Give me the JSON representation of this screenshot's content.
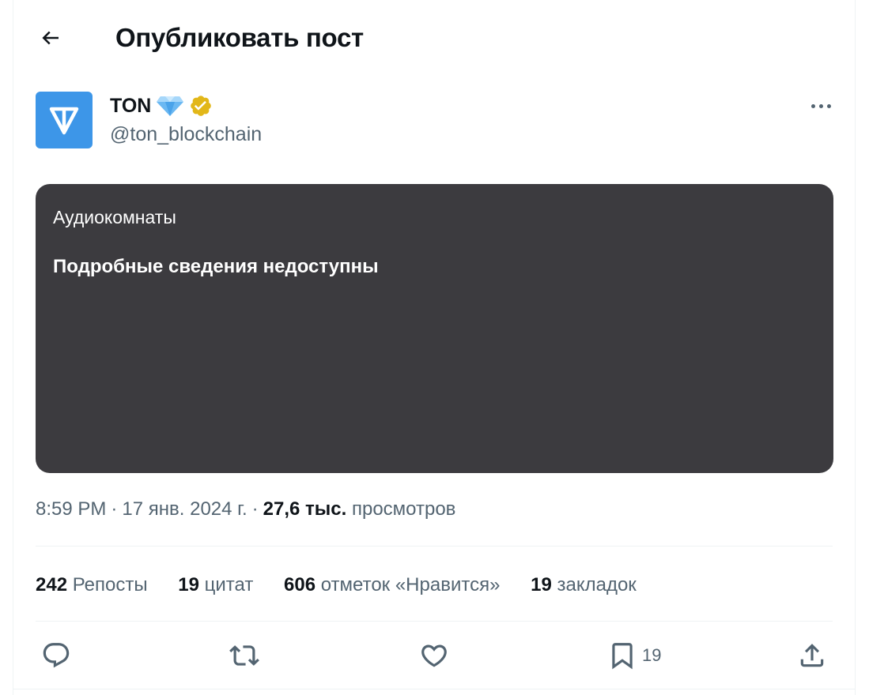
{
  "header": {
    "title": "Опубликовать пост",
    "back_icon": "arrow-left-icon"
  },
  "author": {
    "display_name": "TON",
    "handle": "@ton_blockchain",
    "badges": [
      "diamond-icon",
      "verified-badge-icon"
    ],
    "avatar_color": "#3d96e8",
    "verified_color": "#e2b719"
  },
  "audio_card": {
    "label": "Аудиокомнаты",
    "status": "Подробные сведения недоступны",
    "background": "#3c3b3f"
  },
  "meta": {
    "time": "8:59 PM",
    "separator": "·",
    "date": "17 янв. 2024 г.",
    "views_count": "27,6 тыс.",
    "views_label": "просмотров"
  },
  "stats": {
    "reposts_count": "242",
    "reposts_label": "Репосты",
    "quotes_count": "19",
    "quotes_label": "цитат",
    "likes_count": "606",
    "likes_label": "отметок «Нравится»",
    "bookmarks_count": "19",
    "bookmarks_label": "закладок"
  },
  "actions": {
    "reply_icon": "reply-icon",
    "repost_icon": "repost-icon",
    "like_icon": "heart-icon",
    "bookmark_icon": "bookmark-icon",
    "bookmark_count": "19",
    "share_icon": "share-icon"
  }
}
